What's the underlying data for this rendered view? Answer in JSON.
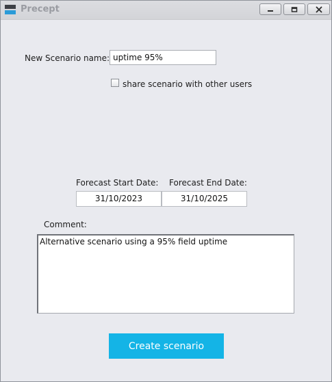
{
  "window": {
    "title": "Precept"
  },
  "form": {
    "scenario_name_label": "New Scenario name:",
    "scenario_name_value": "uptime 95%",
    "share_label": "share scenario with other users",
    "share_checked": false,
    "forecast_start_label": "Forecast Start Date:",
    "forecast_start_value": "31/10/2023",
    "forecast_end_label": "Forecast End Date:",
    "forecast_end_value": "31/10/2025",
    "comment_label": "Comment:",
    "comment_value": "Alternative scenario using a 95% field uptime",
    "create_button_label": "Create scenario"
  },
  "colors": {
    "accent": "#14b4e6",
    "window_background": "#e9eaef",
    "app_icon_blue": "#2a9bd8"
  }
}
